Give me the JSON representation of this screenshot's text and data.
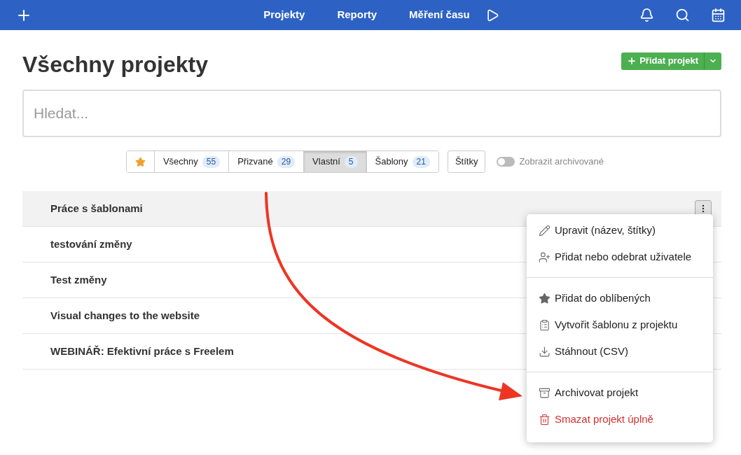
{
  "nav": {
    "links": [
      {
        "label": "Projekty"
      },
      {
        "label": "Reporty"
      },
      {
        "label": "Měření času"
      }
    ]
  },
  "title": "Všechny projekty",
  "add_button": {
    "label": "Přidat projekt"
  },
  "search": {
    "placeholder": "Hledat..."
  },
  "filters": [
    {
      "kind": "star",
      "selected": false
    },
    {
      "kind": "tab",
      "label": "Všechny",
      "count": "55",
      "selected": false
    },
    {
      "kind": "tab",
      "label": "Přizvané",
      "count": "29",
      "selected": false
    },
    {
      "kind": "tab",
      "label": "Vlastní",
      "count": "5",
      "selected": true
    },
    {
      "kind": "tab",
      "label": "Šablony",
      "count": "21",
      "selected": false
    }
  ],
  "tags_button": "Štítky",
  "archived_toggle": {
    "label": "Zobrazit archivované",
    "on": false
  },
  "projects": [
    {
      "name": "Práce s šablonami",
      "hovered": true
    },
    {
      "name": "testování změny",
      "hovered": false
    },
    {
      "name": "Test změny",
      "hovered": false
    },
    {
      "name": "Visual changes to the website",
      "hovered": false
    },
    {
      "name": "WEBINÁŘ: Efektivní práce s Freelem",
      "hovered": false
    }
  ],
  "menu": [
    [
      {
        "label": "Upravit (název, štítky)",
        "kind": "default"
      },
      {
        "label": "Přidat nebo odebrat uživatele",
        "kind": "default"
      }
    ],
    [
      {
        "label": "Přidat do oblíbených",
        "kind": "default"
      },
      {
        "label": "Vytvořit šablonu z projektu",
        "kind": "default"
      },
      {
        "label": "Stáhnout (CSV)",
        "kind": "default"
      }
    ],
    [
      {
        "label": "Archivovat projekt",
        "kind": "default"
      },
      {
        "label": "Smazat projekt úplně",
        "kind": "danger"
      }
    ]
  ]
}
